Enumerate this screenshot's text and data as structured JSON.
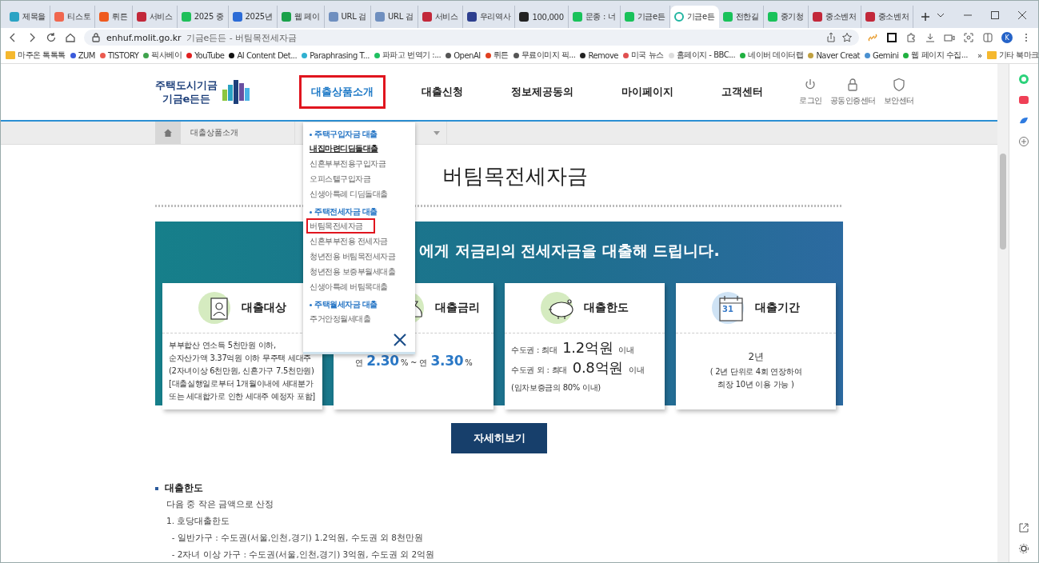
{
  "browser": {
    "tabs": [
      {
        "label": "제목을",
        "color": "#2aa3c4",
        "selected": false
      },
      {
        "label": "티스토",
        "color": "#f0674f",
        "selected": false
      },
      {
        "label": "뤼튼",
        "color": "#ef5a1e",
        "selected": false
      },
      {
        "label": "서비스",
        "color": "#c2283a",
        "selected": false
      },
      {
        "label": "2025 중",
        "color": "#1fbf5a",
        "selected": false
      },
      {
        "label": "2025년",
        "color": "#2b6bd6",
        "selected": false
      },
      {
        "label": "웹 페이",
        "color": "#1aa14a",
        "selected": false
      },
      {
        "label": "URL 검",
        "color": "#6f8fbf",
        "selected": false
      },
      {
        "label": "URL 검",
        "color": "#6f8fbf",
        "selected": false
      },
      {
        "label": "서비스",
        "color": "#c2283a",
        "selected": false
      },
      {
        "label": "우리역사",
        "color": "#2d3f8f",
        "selected": false
      },
      {
        "label": "100,000",
        "color": "#222222",
        "selected": false
      },
      {
        "label": "문종 : 너",
        "color": "#19c25a",
        "selected": false
      },
      {
        "label": "기금e든",
        "color": "#19c25a",
        "selected": false
      },
      {
        "label": "기금e든",
        "color": "#1fb5a0",
        "selected": true
      },
      {
        "label": "전한길",
        "color": "#19c25a",
        "selected": false
      },
      {
        "label": "중기청",
        "color": "#19c25a",
        "selected": false
      },
      {
        "label": "중소벤처",
        "color": "#c2283a",
        "selected": false
      },
      {
        "label": "중소벤처",
        "color": "#c2283a",
        "selected": false
      }
    ],
    "address": {
      "url": "enhuf.molit.go.kr",
      "page_title": "기금e든든 - 버팀목전세자금"
    },
    "profile_initial": "K",
    "bookmarks": [
      {
        "label": "마주온 톡톡톡",
        "kind": "folder",
        "color": "#f5b82e"
      },
      {
        "label": "ZUM",
        "kind": "site",
        "color": "#3b5bdb"
      },
      {
        "label": "TISTORY",
        "kind": "site",
        "color": "#eb5a4f"
      },
      {
        "label": "픽사베이",
        "kind": "site",
        "color": "#3fa34d"
      },
      {
        "label": "YouTube",
        "kind": "site",
        "color": "#e02020"
      },
      {
        "label": "AI Content Det...",
        "kind": "site",
        "color": "#111111"
      },
      {
        "label": "Paraphrasing T...",
        "kind": "site",
        "color": "#30b0d0"
      },
      {
        "label": "파파고 번역기 :...",
        "kind": "site",
        "color": "#20c060"
      },
      {
        "label": "OpenAI",
        "kind": "site",
        "color": "#555555"
      },
      {
        "label": "뤼튼",
        "kind": "site",
        "color": "#e04020"
      },
      {
        "label": "무료이미지 픽...",
        "kind": "site",
        "color": "#555555"
      },
      {
        "label": "Remove",
        "kind": "site",
        "color": "#222222"
      },
      {
        "label": "미국 뉴스",
        "kind": "site",
        "color": "#e05050"
      },
      {
        "label": "홈페이지 - BBC...",
        "kind": "site",
        "color": "#dddddd"
      },
      {
        "label": "네이버 데이터랩",
        "kind": "site",
        "color": "#20b040"
      },
      {
        "label": "Naver Creat",
        "kind": "site",
        "color": "#c0a040"
      },
      {
        "label": "Gemini",
        "kind": "site",
        "color": "#4a90d0"
      },
      {
        "label": "웹 페이지 수집...",
        "kind": "site",
        "color": "#20b040"
      }
    ],
    "more_bookmarks": "»",
    "other_bookmarks": "기타 북마크"
  },
  "header": {
    "logo_line1": "주택도시기금",
    "logo_line2": "기금e든든",
    "nav": [
      {
        "label": "대출상품소개",
        "selected": true,
        "highlighted": true
      },
      {
        "label": "대출신청",
        "selected": false,
        "highlighted": false
      },
      {
        "label": "정보제공동의",
        "selected": false,
        "highlighted": false
      },
      {
        "label": "마이페이지",
        "selected": false,
        "highlighted": false
      },
      {
        "label": "고객센터",
        "selected": false,
        "highlighted": false
      }
    ],
    "utilities": [
      {
        "label": "로그인",
        "kind": "power"
      },
      {
        "label": "공동인증센터",
        "kind": "lock"
      },
      {
        "label": "보안센터",
        "kind": "shield"
      }
    ]
  },
  "breadcrumb": {
    "first": "대출상품소개"
  },
  "dropdown": {
    "groups": [
      {
        "heading": "주택구입자금 대출",
        "items": [
          {
            "label": "내집마련디딤돌대출",
            "hovered": true,
            "highlighted": false
          },
          {
            "label": "신혼부부전용구입자금",
            "hovered": false,
            "highlighted": false
          },
          {
            "label": "오피스텔구입자금",
            "hovered": false,
            "highlighted": false
          },
          {
            "label": "신생아특례 디딤돌대출",
            "hovered": false,
            "highlighted": false
          }
        ]
      },
      {
        "heading": "주택전세자금 대출",
        "items": [
          {
            "label": "버팀목전세자금",
            "hovered": false,
            "highlighted": true
          },
          {
            "label": "신혼부부전용 전세자금",
            "hovered": false,
            "highlighted": false
          },
          {
            "label": "청년전용 버팀목전세자금",
            "hovered": false,
            "highlighted": false
          },
          {
            "label": "청년전용 보증부월세대출",
            "hovered": false,
            "highlighted": false
          },
          {
            "label": "신생아특례 버팀목대출",
            "hovered": false,
            "highlighted": false
          }
        ]
      },
      {
        "heading": "주택월세자금 대출",
        "items": [
          {
            "label": "주거안정월세대출",
            "hovered": false,
            "highlighted": false
          }
        ]
      }
    ]
  },
  "page_title": "버팀목전세자금",
  "banner": {
    "headline": "에게 저금리의 전세자금을 대출해 드립니다.",
    "cards": [
      {
        "kind": "person",
        "title": "대출대상",
        "lines": [
          "부부합산 연소득 5천만원 이하,",
          "순자산가액 3.37억원 이하 무주택 세대주",
          "(2자녀이상 6천만원, 신혼가구 7.5천만원)",
          "[대출실행일로부터 1개월이내에 세대분가",
          "또는 세대합가로 인한 세대주 예정자 포함]"
        ]
      },
      {
        "kind": "money",
        "title": "대출금리",
        "lines": [
          "연 **2.30**% ~ 연 **3.30**%"
        ]
      },
      {
        "kind": "piggy",
        "title": "대출한도",
        "lines": [
          "수도권 : 최대 **1.2억원** 이내",
          "수도권 외 : 최대 **0.8억원** 이내",
          "(임차보증금의 80% 이내)"
        ]
      },
      {
        "kind": "calendar",
        "title": "대출기간",
        "calendar_day": "31",
        "lines": [
          "2년",
          "( 2년 단위로 4회 연장하여",
          "최장 10년 이용 가능 )"
        ]
      }
    ]
  },
  "detail_button": "자세히보기",
  "section": {
    "heading": "대출한도",
    "lines": [
      "다음 중 작은 금액으로 산정",
      "1. 호당대출한도",
      "  - 일반가구 : 수도권(서울,인천,경기) 1.2억원, 수도권 외 8천만원",
      "  - 2자녀 이상 가구 : 수도권(서울,인천,경기) 3억원, 수도권 외 2억원"
    ]
  }
}
